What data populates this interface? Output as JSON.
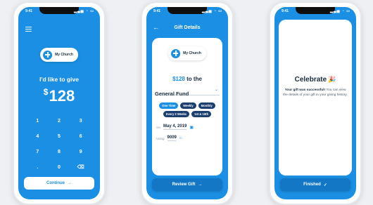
{
  "status": {
    "time": "9:41",
    "icons": "▂▃▅ ◔ ▭"
  },
  "screen1": {
    "church_label": "My Church",
    "give_title": "I'd like to give",
    "currency": "$",
    "amount": "128",
    "keys": [
      "1",
      "2",
      "3",
      "4",
      "5",
      "6",
      "7",
      "8",
      "9",
      ".",
      "0",
      "⌫"
    ],
    "continue_label": "Continue",
    "arrow": "→"
  },
  "screen2": {
    "back": "←",
    "title": "Gift Details",
    "church_label": "My Church",
    "amount": "$128",
    "amount_suffix": "to the",
    "fund": "General Fund",
    "fund_chevron": "⌄",
    "frequencies_row1": [
      "One Time",
      "Weekly",
      "Monthly"
    ],
    "frequencies_row2": [
      "Every 2 Weeks",
      "1st & 15th"
    ],
    "active_frequency": "One Time",
    "date_label": "On",
    "date_value": "May 4, 2019",
    "calendar_icon": "▣",
    "account_label": "Using",
    "account_value": "9009",
    "bank_icon": "⌂",
    "review_label": "Review Gift",
    "arrow": "→"
  },
  "screen3": {
    "title": "Celebrate",
    "party_icon": "🎉",
    "success_bold": "Your gift was successful!",
    "success_rest": "You can view the details of your gift in your giving history.",
    "finished_label": "Finished",
    "check": "✓"
  },
  "colors": {
    "primary": "#1a8fe3",
    "dark_chip": "#1b3f6e"
  }
}
